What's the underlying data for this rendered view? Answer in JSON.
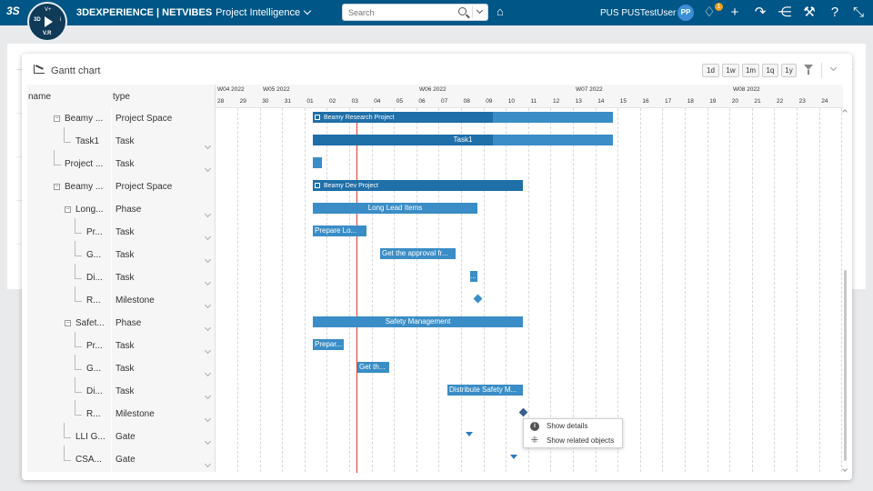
{
  "topbar": {
    "brand_bold": "3DEXPERIENCE | NETVIBES",
    "app_name": "Project Intelligence",
    "search_placeholder": "Search",
    "user_name": "PUS PUSTestUser",
    "avatar_initials": "PP",
    "notifications_count": "1",
    "compass_version": "V.R",
    "compass_3d": "3D",
    "compass_top": "V+",
    "compass_right": "i",
    "ds_logo": "3S"
  },
  "gantt": {
    "title": "Gantt chart",
    "zoom_buttons": [
      "1d",
      "1w",
      "1m",
      "1q",
      "1y"
    ],
    "columns": {
      "name": "name",
      "type": "type"
    },
    "weeks": [
      "W04 2022",
      "W05 2022",
      "W06 2022",
      "W07 2022",
      "W08 2022"
    ],
    "days": [
      "28",
      "29",
      "30",
      "31",
      "01",
      "02",
      "03",
      "04",
      "05",
      "06",
      "07",
      "08",
      "09",
      "10",
      "11",
      "12",
      "13",
      "14",
      "15",
      "16",
      "17",
      "18",
      "19",
      "20",
      "21",
      "22",
      "23",
      "24"
    ],
    "rows": [
      {
        "name": "Beamy ...",
        "type": "Project Space"
      },
      {
        "name": "Task1",
        "type": "Task"
      },
      {
        "name": "Project ...",
        "type": "Task"
      },
      {
        "name": "Beamy ...",
        "type": "Project Space"
      },
      {
        "name": "Long...",
        "type": "Phase"
      },
      {
        "name": "Pr...",
        "type": "Task"
      },
      {
        "name": "G...",
        "type": "Task"
      },
      {
        "name": "Di...",
        "type": "Task"
      },
      {
        "name": "R...",
        "type": "Milestone"
      },
      {
        "name": "Safet...",
        "type": "Phase"
      },
      {
        "name": "Pr...",
        "type": "Task"
      },
      {
        "name": "G...",
        "type": "Task"
      },
      {
        "name": "Di...",
        "type": "Task"
      },
      {
        "name": "R...",
        "type": "Milestone"
      },
      {
        "name": "LLI G...",
        "type": "Gate"
      },
      {
        "name": "CSA...",
        "type": "Gate"
      }
    ],
    "bars": {
      "beamy_research": "Beamy Research Project",
      "task1": "Task1",
      "beamy_dev": "Beamy Dev Project",
      "long_lead": "Long Lead Items",
      "prepare_lo": "Prepare Lo...",
      "get_approval": "Get the approval fr...",
      "di_short": "...",
      "safety": "Safety Management",
      "prepar": "Prepar...",
      "get_th": "Get th...",
      "distribute": "Distribute Safety M..."
    },
    "context_menu": {
      "show_details": "Show details",
      "show_related": "Show related objects"
    }
  },
  "colors": {
    "topbar": "#005686",
    "bar": "#3a8dc6",
    "bar_progress": "#1f6fa8",
    "today_line": "#e03c31"
  },
  "icons": [
    "search-icon",
    "tag-icon",
    "notification-icon",
    "add-icon",
    "share-icon",
    "network-icon",
    "tools-icon",
    "help-icon",
    "fullscreen-icon",
    "filter-icon",
    "chart-icon",
    "info-icon",
    "related-icon"
  ]
}
